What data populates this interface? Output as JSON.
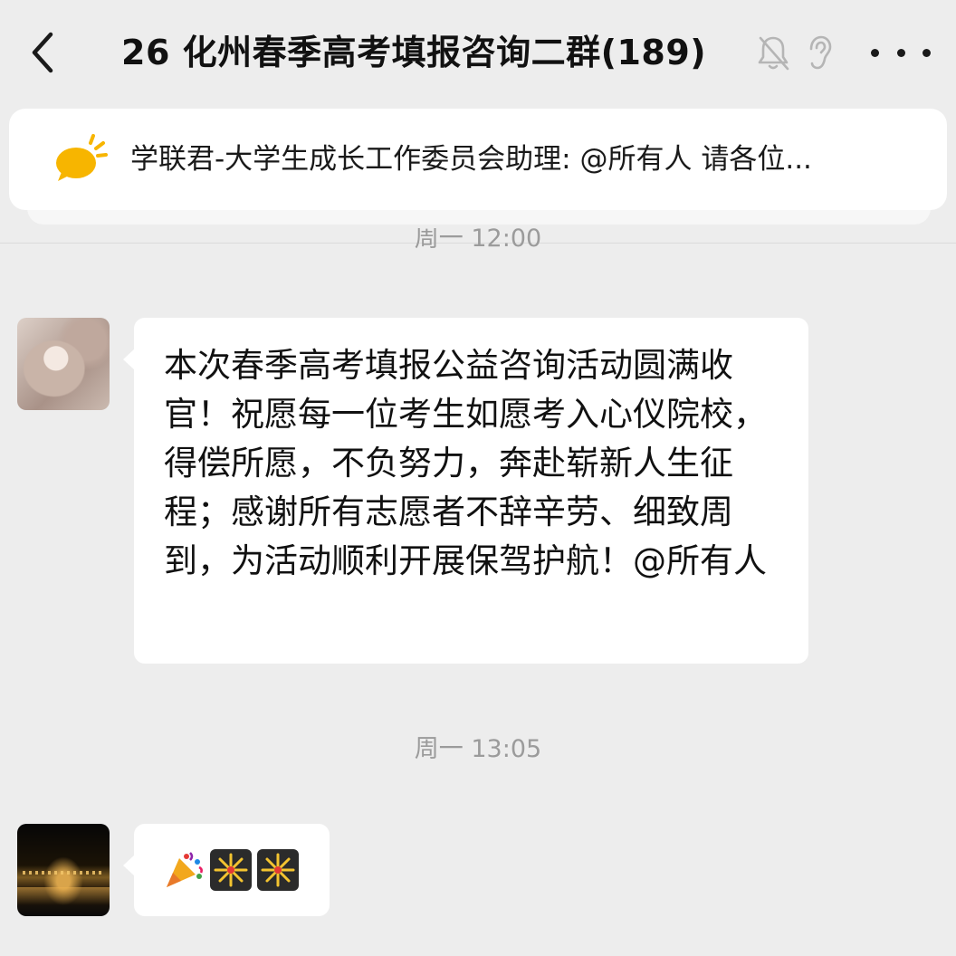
{
  "header": {
    "title": "26 化州春季高考填报咨询二群(189)",
    "back_icon": "chevron-left-icon",
    "mute_icon": "bell-off-icon",
    "ear_icon": "ear-icon",
    "more_icon": "more-dots-icon"
  },
  "pinned": {
    "icon": "announcement-bubble-icon",
    "accent": "#f7b500",
    "text": "学联君-大学生成长工作委员会助理: @所有人 请各位..."
  },
  "chat": {
    "timestamp_partial": "周一 12:00",
    "messages": [
      {
        "text": "本次春季高考填报公益咨询活动圆满收官！祝愿每一位考生如愿考入心仪院校，得偿所愿，不负努力，奔赴崭新人生征程；感谢所有志愿者不辞辛劳、细致周到，为活动顺利开展保驾护航！@所有人"
      }
    ],
    "timestamp_2": "周一 13:05",
    "emoji_message": {
      "emojis": [
        "party-popper-emoji",
        "fireworks-emoji",
        "fireworks-emoji"
      ]
    }
  },
  "colors": {
    "background": "#ededed",
    "bubble": "#ffffff",
    "timestamp": "#9b9b9b"
  }
}
